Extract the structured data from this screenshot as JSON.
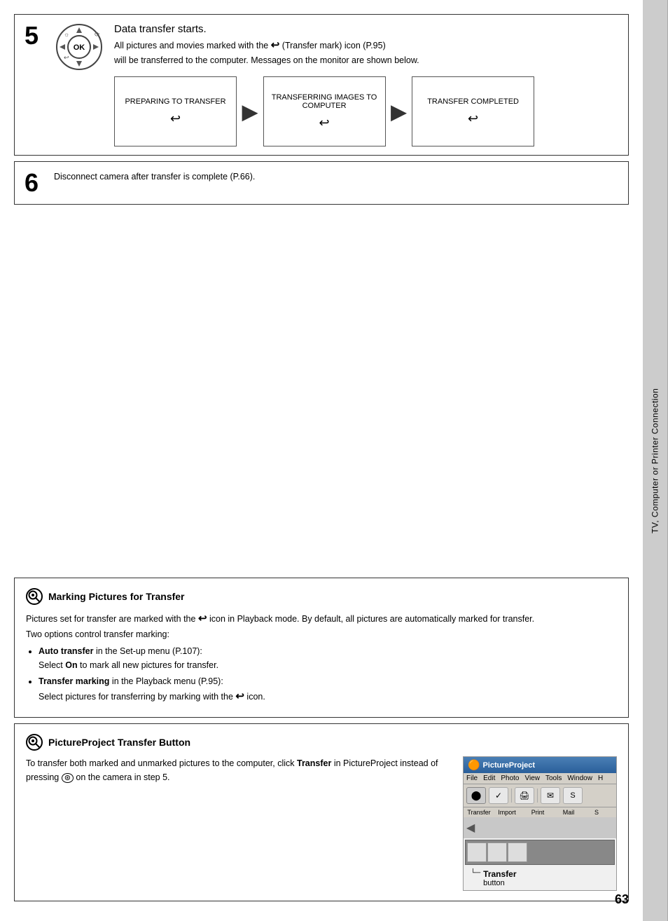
{
  "page": {
    "number": "63"
  },
  "sidebar": {
    "label": "TV, Computer or Printer Connection"
  },
  "step5": {
    "number": "5",
    "title": "Data transfer starts.",
    "desc1": "All pictures and movies marked with the",
    "desc_icon": "↩",
    "desc2": "(Transfer mark) icon (P.95)",
    "desc3": "will be transferred to the computer. Messages on the monitor are shown below.",
    "screens": [
      {
        "label": "PREPARING TO TRANSFER"
      },
      {
        "label": "TRANSFERRING IMAGES TO\nCOMPUTER"
      },
      {
        "label": "TRANSFER COMPLETED"
      }
    ]
  },
  "step6": {
    "number": "6",
    "text": "Disconnect camera after transfer is complete (P.66)."
  },
  "note1": {
    "icon": "🔍",
    "title": "Marking Pictures for Transfer",
    "body_lines": [
      "Pictures set for transfer are marked with the ↩ icon in Playback mode. By default, all pictures are automatically marked for transfer.",
      "Two options control transfer marking:"
    ],
    "bullets": [
      {
        "label": "Auto transfer",
        "rest": " in the Set-up menu (P.107):\nSelect On to mark all new pictures for transfer."
      },
      {
        "label": "Transfer marking",
        "rest": " in the Playback menu (P.95):\nSelect pictures for transferring by marking with the ↩ icon."
      }
    ]
  },
  "note2": {
    "icon": "🔍",
    "title": "PictureProject Transfer Button",
    "body": "To transfer both marked and unmarked pictures to the computer, click",
    "bold": "Transfer",
    "body2": "in PictureProject instead of pressing",
    "icon2": "⊛",
    "body3": "on the camera in step 5.",
    "screenshot": {
      "title": "PictureProject",
      "menubar": [
        "File",
        "Edit",
        "Photo",
        "View",
        "Tools",
        "Window",
        "H"
      ],
      "buttons": [
        "⬤",
        "✓",
        "🖨",
        "✉"
      ],
      "labels": [
        "Transfer",
        "Import",
        "Print",
        "Mail",
        "S"
      ]
    },
    "transfer_label": "Transfer",
    "button_word": "button"
  }
}
